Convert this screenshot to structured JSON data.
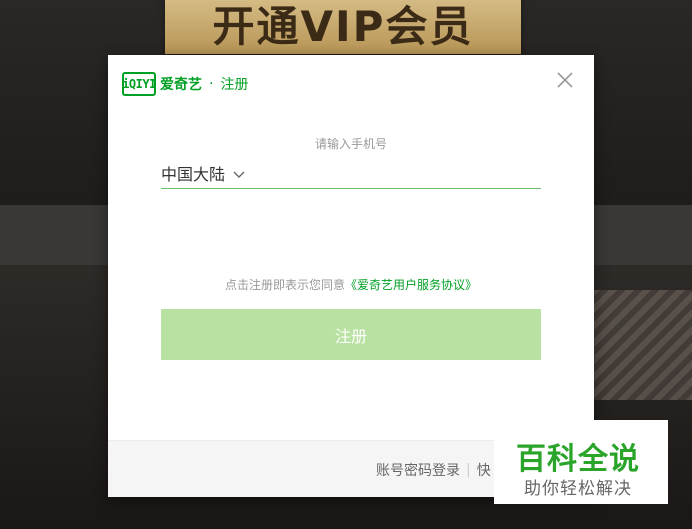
{
  "background": {
    "banner_text": "开通VIP会员"
  },
  "modal": {
    "logo_text": "iQIYI",
    "brand": "爱奇艺",
    "separator": "·",
    "title": "注册",
    "close_icon": "close-icon",
    "phone_hint": "请输入手机号",
    "region": "中国大陆",
    "phone_value": "",
    "agreement_prefix": "点击注册即表示您同意",
    "agreement_link": "《爱奇艺用户服务协议》",
    "register_button": "注册",
    "footer": {
      "password_login": "账号密码登录",
      "separator": "|",
      "quick_login_partial": "快"
    }
  },
  "watermark": {
    "title": "百科全说",
    "subtitle": "助你轻松解决"
  },
  "colors": {
    "brand_green": "#00a025",
    "button_disabled": "#b8e1a2"
  }
}
